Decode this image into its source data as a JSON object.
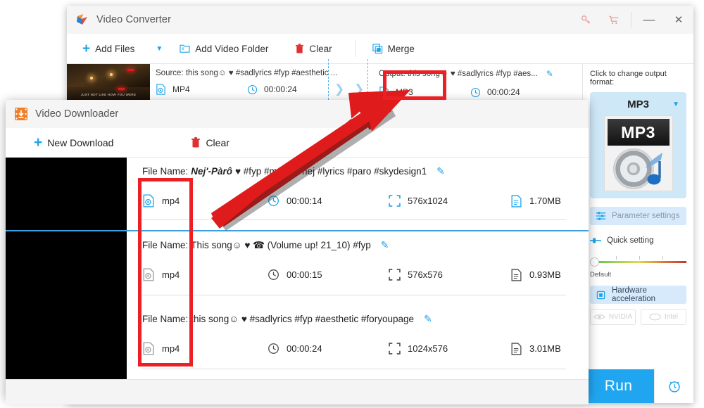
{
  "converter": {
    "title": "Video Converter",
    "logo_icon": "play-triangle-logo",
    "titlebar_icons": [
      {
        "name": "key-icon",
        "glyph": "⚷"
      },
      {
        "name": "cart-icon",
        "glyph": "Ὥ2"
      }
    ],
    "window_buttons": {
      "minimize": "—",
      "close": "✕"
    },
    "toolbar": {
      "add_files": "Add Files",
      "add_files_caret": "▼",
      "add_video_folder": "Add Video Folder",
      "clear": "Clear",
      "merge": "Merge"
    },
    "row": {
      "source_label": "Source: this song☺ ♥ #sadlyrics #fyp #aesthetic ...",
      "source_format": "MP4",
      "source_duration": "00:00:24",
      "output_label": "Output: this song☺ ♥ #sadlyrics #fyp #aes...",
      "output_format": "MP3",
      "output_duration": "00:00:24",
      "edit_icon": "pencil-icon",
      "close_icon": "close-icon",
      "thumb_caption": "JUST NOT LIKE HOW YOU WERE"
    },
    "right_panel": {
      "hint": "Click to change output format:",
      "format_name": "MP3",
      "format_caret": "▼",
      "format_thumb_label": "MP3",
      "parameter_settings": "Parameter settings",
      "quick_setting": "Quick setting",
      "slider_label": "Default",
      "hardware_acceleration": "Hardware acceleration",
      "gpu_chips": [
        "NVIDIA",
        "Intel"
      ],
      "run_button": "Run",
      "alarm_icon": "alarm-clock-icon"
    }
  },
  "downloader": {
    "title": "Video Downloader",
    "logo_icon": "download-film-logo",
    "toolbar": {
      "new_download": "New Download",
      "clear": "Clear"
    },
    "file_name_prefix": "File Name:",
    "rows": [
      {
        "name_bold": "Nej'-Pàrô",
        "name_rest": "♥ #fyp #music #nej #lyrics #paro #skydesign1",
        "format": "mp4",
        "duration": "00:00:14",
        "resolution": "576x1024",
        "size": "1.70MB",
        "format_icon_active": true
      },
      {
        "name_bold": "",
        "name_rest": "This song☺ ♥ ☎ (Volume up! 21_10) #fyp",
        "format": "mp4",
        "duration": "00:00:15",
        "resolution": "576x576",
        "size": "0.93MB",
        "format_icon_active": false
      },
      {
        "name_bold": "",
        "name_rest": "this song☺ ♥ #sadlyrics #fyp #aesthetic #foryoupage",
        "format": "mp4",
        "duration": "00:00:24",
        "resolution": "1024x576",
        "size": "3.01MB",
        "format_icon_active": false
      }
    ],
    "edit_icon": "pencil-icon"
  },
  "annotations": {
    "highlight_color": "#ec2024",
    "arrow": "red-arrow-pointing-to-mp3",
    "boxes": [
      {
        "name": "mp3-output-highlight"
      },
      {
        "name": "mp4-source-column-highlight"
      }
    ]
  }
}
